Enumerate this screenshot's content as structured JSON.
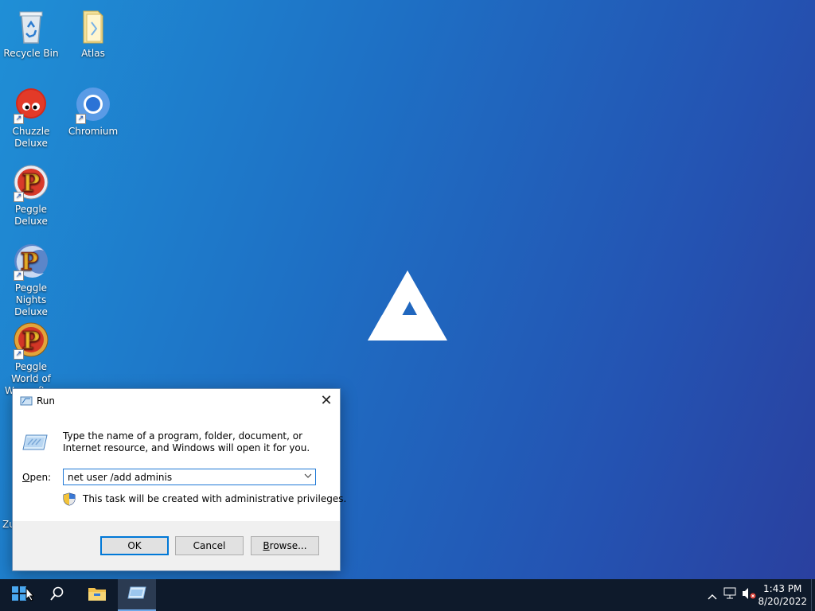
{
  "desktop": {
    "icons": [
      {
        "label": "Recycle Bin"
      },
      {
        "label": "Atlas"
      },
      {
        "label": "Chuzzle Deluxe"
      },
      {
        "label": "Chromium"
      },
      {
        "label": "Peggle Deluxe"
      },
      {
        "label": "Peggle Nights Deluxe"
      },
      {
        "label": "Peggle World of Warcraft ..."
      },
      {
        "label": "Zu"
      }
    ]
  },
  "run_dialog": {
    "title": "Run",
    "description": "Type the name of a program, folder, document, or Internet resource, and Windows will open it for you.",
    "open_label_underlined": "O",
    "open_label_rest": "pen:",
    "input_value": "net user /add adminis",
    "admin_note": "This task will be created with administrative privileges.",
    "ok_label": "OK",
    "cancel_label": "Cancel",
    "browse_underlined": "B",
    "browse_rest": "rowse..."
  },
  "taskbar": {
    "time": "1:43 PM",
    "date": "8/20/2022"
  },
  "colors": {
    "accent": "#0078d7",
    "taskbar": "#0e1a2b"
  }
}
